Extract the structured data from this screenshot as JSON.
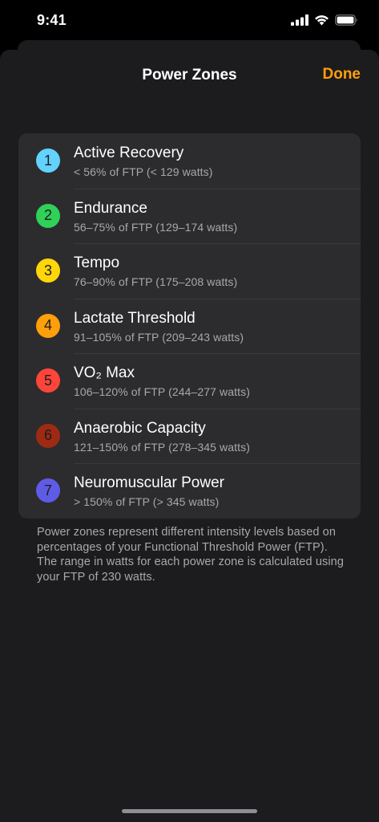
{
  "status_bar": {
    "time": "9:41",
    "icons": [
      "cellular-signal-icon",
      "wifi-icon",
      "battery-icon"
    ]
  },
  "nav": {
    "title": "Power Zones",
    "done_label": "Done"
  },
  "colors": {
    "accent": "#ff9f0a",
    "background": "#1c1c1e",
    "card": "#2c2c2e"
  },
  "zones": [
    {
      "number": "1",
      "name": "Active Recovery",
      "range": "< 56% of FTP (< 129 watts)",
      "color": "#64d2ff"
    },
    {
      "number": "2",
      "name": "Endurance",
      "range": "56–75% of FTP (129–174 watts)",
      "color": "#30d158"
    },
    {
      "number": "3",
      "name": "Tempo",
      "range": "76–90% of FTP (175–208 watts)",
      "color": "#ffd60a"
    },
    {
      "number": "4",
      "name": "Lactate Threshold",
      "range": "91–105% of FTP (209–243 watts)",
      "color": "#ff9f0a"
    },
    {
      "number": "5",
      "name": "VO₂ Max",
      "range": "106–120% of FTP (244–277 watts)",
      "color": "#ff453a"
    },
    {
      "number": "6",
      "name": "Anaerobic Capacity",
      "range": "121–150% of FTP (278–345 watts)",
      "color": "#9e2a14"
    },
    {
      "number": "7",
      "name": "Neuromuscular Power",
      "range": "> 150% of FTP (> 345 watts)",
      "color": "#5e5ce6"
    }
  ],
  "footer": {
    "note": "Power zones represent different intensity levels based on percentages of your Functional Threshold Power (FTP). The range in watts for each power zone is calculated using your FTP of 230 watts."
  }
}
